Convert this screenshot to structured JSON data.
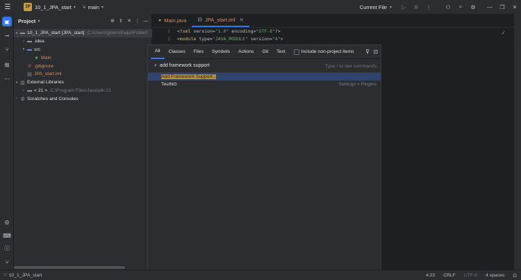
{
  "titlebar": {
    "project_badge": "1P",
    "project_name": "10_1_JPA_start",
    "branch": "main",
    "run_config": "Current File",
    "icons": [
      "menu-icon",
      "run-icon",
      "debug-icon",
      "more-icon",
      "user-icon",
      "search-icon",
      "settings-icon",
      "minimize-icon",
      "restore-icon",
      "close-icon"
    ]
  },
  "toolstrip": {
    "top": [
      "project-icon",
      "commit-icon",
      "vcs-icon",
      "structure-icon",
      "more-tools-icon"
    ],
    "bottom": [
      "services-icon",
      "terminal-icon",
      "problems-icon",
      "git-icon"
    ]
  },
  "project_panel": {
    "title": "Project",
    "tree": [
      {
        "label": "10_1_JPA_start [JPA_start]",
        "extra": "C:\\Users\\gkwns\\hajunFolder\\",
        "indent": 0,
        "arrow": "▾",
        "icon": "module-folder-icon",
        "color": "#dfe1e5"
      },
      {
        "label": ".idea",
        "extra": "",
        "indent": 1,
        "arrow": "›",
        "icon": "folder-icon",
        "color": "#dfe1e5"
      },
      {
        "label": "src",
        "extra": "",
        "indent": 1,
        "arrow": "▾",
        "icon": "folder-icon",
        "color": "#dfe1e5"
      },
      {
        "label": "Main",
        "extra": "",
        "indent": 2,
        "arrow": "",
        "icon": "java-class-icon",
        "color": "#d5905e"
      },
      {
        "label": ".gitignore",
        "extra": "",
        "indent": 1,
        "arrow": "",
        "icon": "ignore-file-icon",
        "color": "#d5905e"
      },
      {
        "label": "JPA_start.iml",
        "extra": "",
        "indent": 1,
        "arrow": "",
        "icon": "iml-file-icon",
        "color": "#d5905e"
      },
      {
        "label": "External Libraries",
        "extra": "",
        "indent": 0,
        "arrow": "▾",
        "icon": "library-icon",
        "color": "#dfe1e5"
      },
      {
        "label": "< 21 >",
        "extra": "C:\\Program Files\\Java\\jdk-21",
        "indent": 1,
        "arrow": "›",
        "icon": "jdk-icon",
        "color": "#dfe1e5"
      },
      {
        "label": "Scratches and Consoles",
        "extra": "",
        "indent": 0,
        "arrow": "›",
        "icon": "scratches-icon",
        "color": "#dfe1e5"
      }
    ]
  },
  "editor": {
    "tabs": [
      {
        "label": "Main.java",
        "active": false
      },
      {
        "label": "JPA_start.iml",
        "active": true
      }
    ],
    "lines": [
      {
        "num": "1",
        "parts": [
          [
            "t",
            "<?"
          ],
          [
            "k",
            "xml "
          ],
          [
            "t",
            "version="
          ],
          [
            "s",
            "\"1.0\""
          ],
          [
            "t",
            " encoding="
          ],
          [
            "s",
            "\"UTF-8\""
          ],
          [
            "t",
            "?>"
          ]
        ]
      },
      {
        "num": "2",
        "parts": [
          [
            "t",
            "<"
          ],
          [
            "k",
            "module "
          ],
          [
            "t",
            "type="
          ],
          [
            "s",
            "\"JAVA_MODULE\""
          ],
          [
            "t",
            " version="
          ],
          [
            "s",
            "\"4\""
          ],
          [
            "t",
            ">"
          ]
        ]
      }
    ]
  },
  "search_popup": {
    "tabs": [
      "All",
      "Classes",
      "Files",
      "Symbols",
      "Actions",
      "Git",
      "Text"
    ],
    "active_tab": "All",
    "include_label": "Include non-project items",
    "query": "add framework support",
    "hint": "Type / to see commands",
    "results": [
      {
        "label": "Add Framework Support...",
        "meta": "",
        "selected": true
      },
      {
        "label": "TestNG",
        "meta": "Settings > Plugins",
        "selected": false
      }
    ]
  },
  "statusbar": {
    "project": "10_1_JPA_start",
    "position": "4:23",
    "line_sep": "CRLF",
    "encoding": "UTF-8",
    "indent": "4 spaces"
  },
  "colors": {
    "accent": "#3574f0",
    "background": "#1e1f22",
    "panel": "#2b2d30",
    "selection_highlight": "#b78d3e"
  }
}
